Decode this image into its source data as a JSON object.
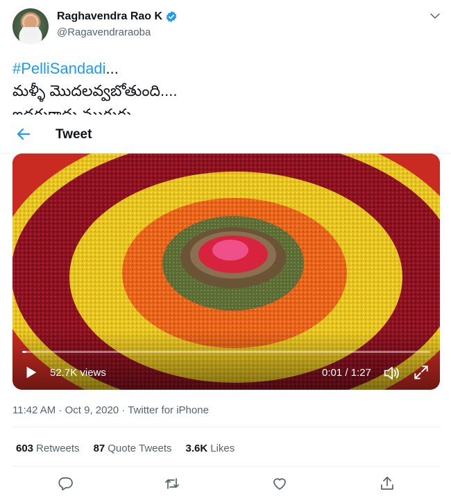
{
  "author": {
    "name": "Raghavendra Rao K",
    "handle": "@Ragavendraraoba",
    "verified": true
  },
  "tweet": {
    "hashtag": "#PelliSandadi",
    "hashtag_suffix": "...",
    "line1": "మళ్ళీ మొదలవ్వబోతుంది....",
    "line2": "ఇద్దరుకాదు ముగ్గురు"
  },
  "header": {
    "title": "Tweet"
  },
  "video": {
    "views": "52.7K views",
    "time": "0:01 / 1:27",
    "progress": 0.01
  },
  "meta": {
    "text": "11:42 AM · Oct 9, 2020 · Twitter for iPhone"
  },
  "stats": {
    "retweets_count": "603",
    "retweets_label": "Retweets",
    "quotes_count": "87",
    "quotes_label": "Quote Tweets",
    "likes_count": "3.6K",
    "likes_label": "Likes"
  },
  "colors": {
    "accent": "#1d9bf0",
    "muted": "#536471",
    "text": "#0f1419"
  },
  "icons": [
    "verified-icon",
    "chevron-down-icon",
    "back-arrow-icon",
    "play-icon",
    "volume-icon",
    "fullscreen-icon",
    "reply-icon",
    "retweet-icon",
    "like-icon",
    "share-icon"
  ]
}
